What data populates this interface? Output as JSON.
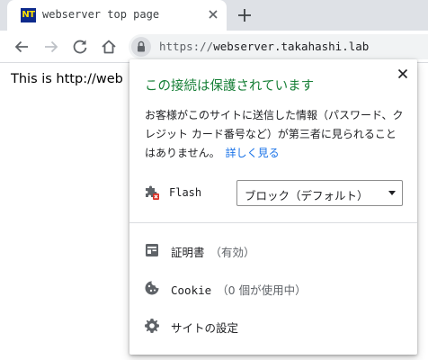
{
  "tab": {
    "favicon_text": "NT",
    "title": "webserver top page"
  },
  "address_bar": {
    "scheme": "https://",
    "host": "webserver.takahashi.lab"
  },
  "page": {
    "text": "This is http://web"
  },
  "popup": {
    "title": "この接続は保護されています",
    "description": "お客様がこのサイトに送信した情報（パスワード、クレジット カード番号など）が第三者に見られることはありません。",
    "details_link": "詳しく見る",
    "flash_label": "Flash",
    "flash_value": "ブロック（デフォルト）",
    "certificate_label": "証明書",
    "certificate_status": "（有効）",
    "cookie_label": "Cookie",
    "cookie_status": "（0 個が使用中）",
    "site_settings_label": "サイトの設定"
  },
  "colors": {
    "secure_green": "#188038",
    "link_blue": "#1a73e8",
    "flash_blocked_red": "#d93025",
    "icon_gray": "#5f6368"
  },
  "icons": {
    "back": "arrow-left-icon",
    "forward": "arrow-right-icon",
    "reload": "reload-icon",
    "home": "home-icon",
    "lock": "lock-icon",
    "close": "close-icon",
    "new_tab": "plus-icon",
    "flash": "puzzle-blocked-icon",
    "certificate": "certificate-icon",
    "cookie": "cookie-icon",
    "settings": "gear-icon"
  }
}
